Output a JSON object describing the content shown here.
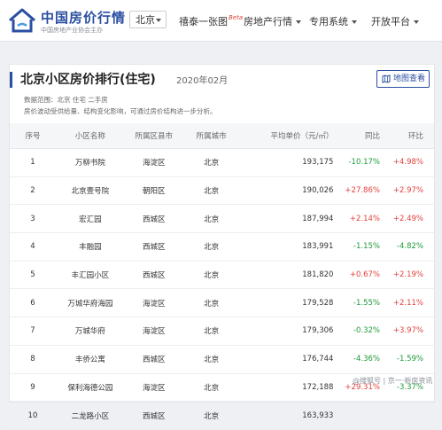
{
  "header": {
    "brand": "中国房价行情",
    "brand_sub": "中国房地产业协会主办",
    "city": "北京",
    "nav": [
      {
        "label": "禧泰一张图",
        "badge": "Beta"
      },
      {
        "label": "房地产行情"
      },
      {
        "label": "专用系统"
      },
      {
        "label": "开放平台"
      }
    ]
  },
  "main": {
    "title": "北京小区房价排行(住宅)",
    "period": "2020年02月",
    "map_button": "地图查看",
    "meta_source": "数据范围：北京  住宅  二手房",
    "meta_note": "房价波动受供给量、结构变化影响，可通过房价结构进一步分析。"
  },
  "table": {
    "columns": [
      "序号",
      "小区名称",
      "所属区县市",
      "所属城市",
      "平均单价（元/㎡）",
      "同比",
      "环比"
    ],
    "rows": [
      {
        "rank": "1",
        "name": "万柳书院",
        "district": "海淀区",
        "city": "北京",
        "price": "193,175",
        "yoy": "-10.17%",
        "mom": "+4.98%"
      },
      {
        "rank": "2",
        "name": "北京壹号院",
        "district": "朝阳区",
        "city": "北京",
        "price": "190,026",
        "yoy": "+27.86%",
        "mom": "+2.97%"
      },
      {
        "rank": "3",
        "name": "宏汇园",
        "district": "西城区",
        "city": "北京",
        "price": "187,994",
        "yoy": "+2.14%",
        "mom": "+2.49%"
      },
      {
        "rank": "4",
        "name": "丰融园",
        "district": "西城区",
        "city": "北京",
        "price": "183,991",
        "yoy": "-1.15%",
        "mom": "-4.82%"
      },
      {
        "rank": "5",
        "name": "丰汇园小区",
        "district": "西城区",
        "city": "北京",
        "price": "181,820",
        "yoy": "+0.67%",
        "mom": "+2.19%"
      },
      {
        "rank": "6",
        "name": "万城华府海园",
        "district": "海淀区",
        "city": "北京",
        "price": "179,528",
        "yoy": "-1.55%",
        "mom": "+2.11%"
      },
      {
        "rank": "7",
        "name": "万城华府",
        "district": "海淀区",
        "city": "北京",
        "price": "179,306",
        "yoy": "-0.32%",
        "mom": "+3.97%"
      },
      {
        "rank": "8",
        "name": "丰侨公寓",
        "district": "西城区",
        "city": "北京",
        "price": "176,744",
        "yoy": "-4.36%",
        "mom": "-1.59%"
      },
      {
        "rank": "9",
        "name": "保利海德公园",
        "district": "海淀区",
        "city": "北京",
        "price": "172,188",
        "yoy": "+29.31%",
        "mom": "-3.37%"
      },
      {
        "rank": "10",
        "name": "二龙路小区",
        "district": "西城区",
        "city": "北京",
        "price": "163,933",
        "yoy": "",
        "mom": ""
      }
    ]
  },
  "watermark": "@搜狐号 | 京一·新房资讯",
  "colors": {
    "brand": "#2a4fa1",
    "up": "#e2423c",
    "down": "#1f9a3a"
  },
  "icons": {
    "logo": "house-logo-icon",
    "map": "map-icon"
  }
}
